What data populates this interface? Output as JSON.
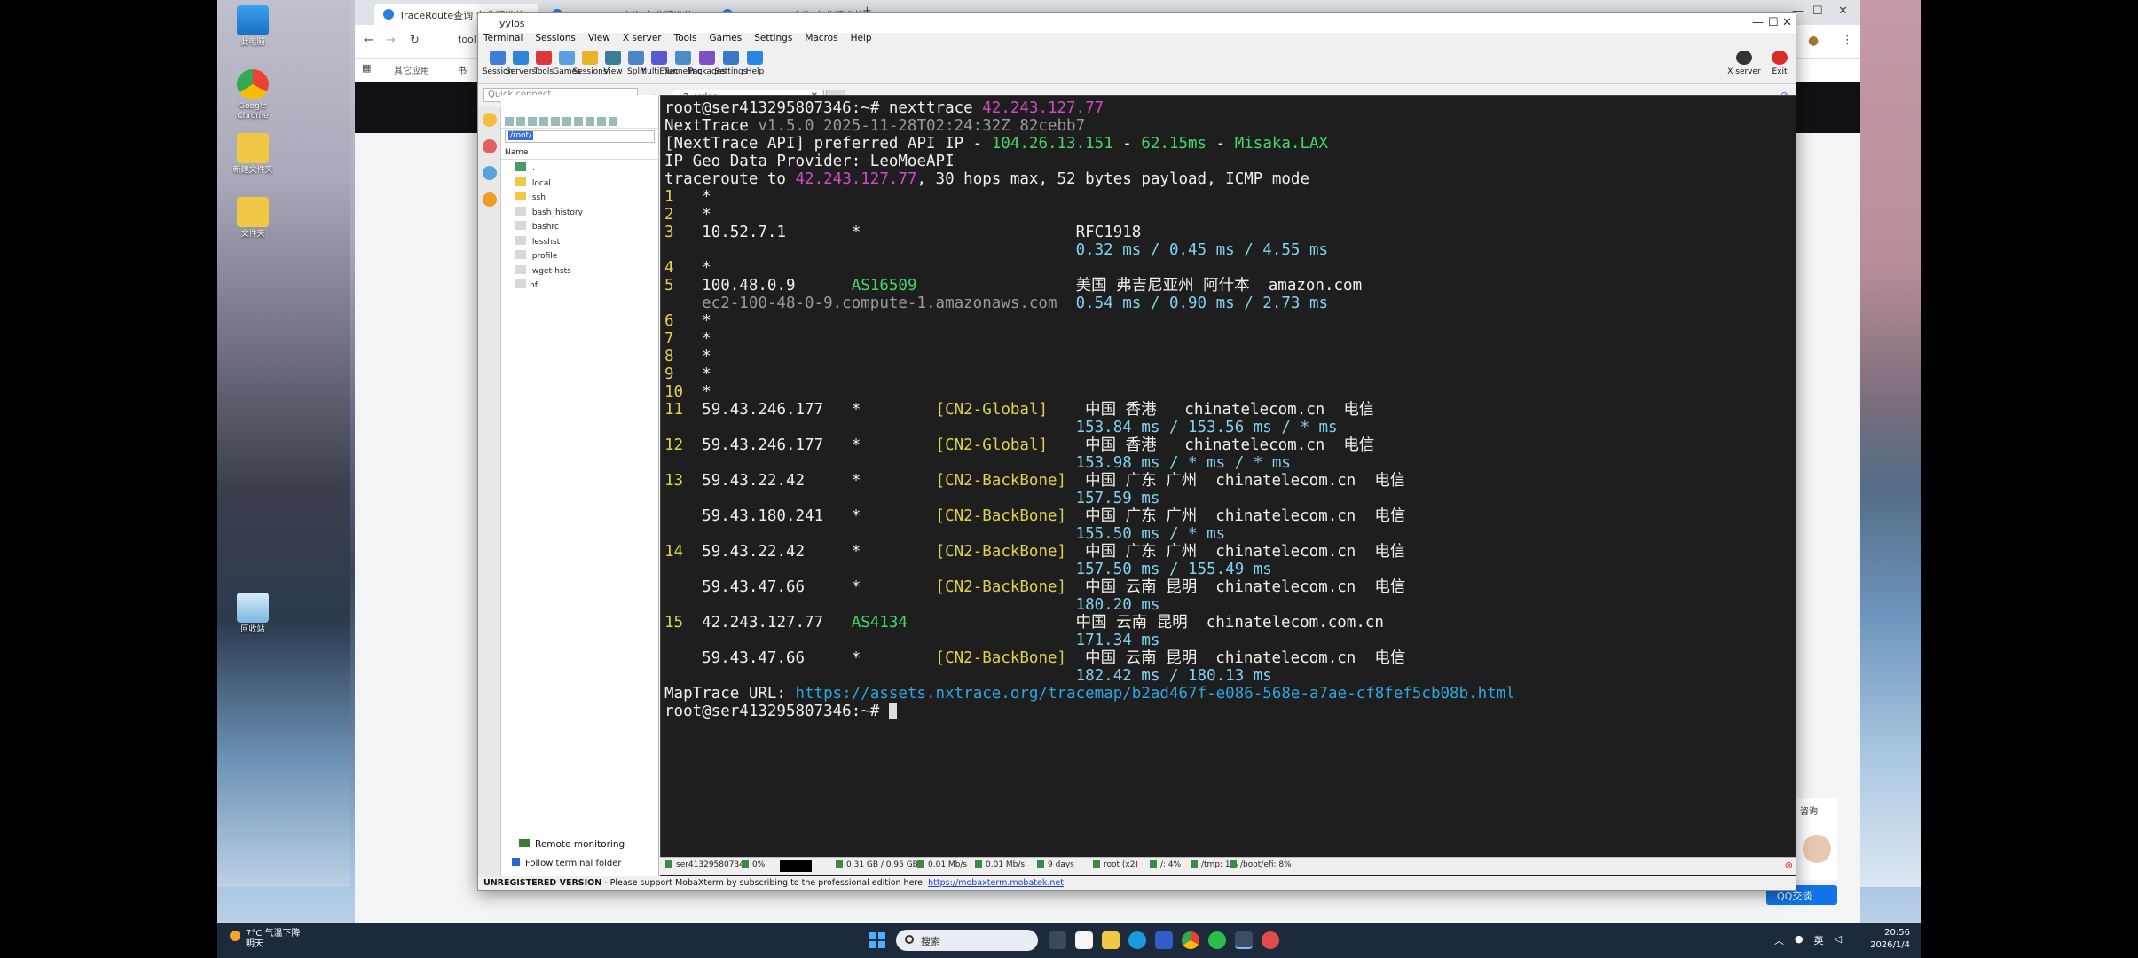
{
  "desktop": {
    "icons": [
      {
        "label": "此电脑"
      },
      {
        "label": "Google Chrome"
      },
      {
        "label": "新建文件夹"
      },
      {
        "label": "文件夹"
      },
      {
        "label": "回收站"
      }
    ]
  },
  "browser": {
    "tabs": [
      {
        "label": "TraceRoute查询 专业精准的IP..."
      },
      {
        "label": "TraceRoute查询 专业精准的IP..."
      },
      {
        "label": "TraceRoute查询 专业精准的IP..."
      }
    ],
    "address_text": "tool",
    "bookmarks": [
      "其它应用",
      "书"
    ]
  },
  "mobaxterm": {
    "window_title": "yylos",
    "menu": [
      "Terminal",
      "Sessions",
      "View",
      "X server",
      "Tools",
      "Games",
      "Settings",
      "Macros",
      "Help"
    ],
    "toolbar": [
      {
        "label": "Session",
        "icon": "session-icon",
        "color": "#3d7fd6"
      },
      {
        "label": "Servers",
        "icon": "servers-icon",
        "color": "#2f86d8"
      },
      {
        "label": "Tools",
        "icon": "tools-icon",
        "color": "#d93a3a"
      },
      {
        "label": "Games",
        "icon": "games-icon",
        "color": "#5aa0e0"
      },
      {
        "label": "Sessions",
        "icon": "sessions-icon",
        "color": "#e8b52a"
      },
      {
        "label": "View",
        "icon": "view-icon",
        "color": "#3a7d9a"
      },
      {
        "label": "Split",
        "icon": "split-icon",
        "color": "#4a86c8"
      },
      {
        "label": "MultiExec",
        "icon": "multiexec-icon",
        "color": "#5a5ad0"
      },
      {
        "label": "Tunneling",
        "icon": "tunneling-icon",
        "color": "#4c8cc8"
      },
      {
        "label": "Packages",
        "icon": "packages-icon",
        "color": "#7c4fc2"
      },
      {
        "label": "Settings",
        "icon": "settings-icon",
        "color": "#3a78c8"
      },
      {
        "label": "Help",
        "icon": "help-icon",
        "color": "#2a86e0"
      }
    ],
    "toolbar_right": [
      {
        "label": "X server",
        "color": "#333333"
      },
      {
        "label": "Exit",
        "color": "#d92b2b"
      }
    ],
    "quick_connect_placeholder": "Quick connect...",
    "tab_label": "2. yylos",
    "sidebar": {
      "path": "/root/",
      "column_header": "Name",
      "files": [
        "..",
        ".local",
        ".ssh",
        ".bash_history",
        ".bashrc",
        ".lesshst",
        ".profile",
        ".wget-hsts",
        "nf"
      ],
      "remote_monitoring": "Remote monitoring",
      "follow_folder": "Follow terminal folder"
    },
    "status": [
      "ser413295807346",
      "0%",
      "0.31 GB / 0.95 GB",
      "0.01 Mb/s",
      "0.01 Mb/s",
      "9 days",
      "root (x2)",
      "/: 4%",
      "/tmp: 1%",
      "/boot/efi: 8%"
    ],
    "unregistered": {
      "label": "UNREGISTERED VERSION",
      "message": " - Please support MobaXterm by subscribing to the professional edition here: ",
      "link": "https://mobaxterm.mobatek.net"
    }
  },
  "terminal": {
    "lines": [
      [
        {
          "t": "root@ser413295807346:~# nexttrace ",
          "c": ""
        },
        {
          "t": "42.243.127.77",
          "c": "cmag"
        }
      ],
      [
        {
          "t": "NextTrace ",
          "c": ""
        },
        {
          "t": "v1.5.0 2025-11-28T02:24:32Z 82cebb7",
          "c": "cgray"
        }
      ],
      [
        {
          "t": "[NextTrace API] preferred API IP - ",
          "c": ""
        },
        {
          "t": "104.26.13.151",
          "c": "cgreen"
        },
        {
          "t": " - ",
          "c": ""
        },
        {
          "t": "62.15ms",
          "c": "cgreen"
        },
        {
          "t": " - ",
          "c": ""
        },
        {
          "t": "Misaka.LAX",
          "c": "cgreen"
        }
      ],
      [
        {
          "t": "IP Geo Data Provider: LeoMoeAPI",
          "c": ""
        }
      ],
      [
        {
          "t": "traceroute to ",
          "c": ""
        },
        {
          "t": "42.243.127.77",
          "c": "cmag"
        },
        {
          "t": ", 30 hops max, 52 bytes payload, ICMP mode",
          "c": ""
        }
      ],
      [
        {
          "t": "1   ",
          "c": "cyel"
        },
        {
          "t": "*",
          "c": ""
        }
      ],
      [
        {
          "t": "2   ",
          "c": "cyel"
        },
        {
          "t": "*",
          "c": ""
        }
      ],
      [
        {
          "t": "3   ",
          "c": "cyel"
        },
        {
          "t": "10.52.7.1       *                       RFC1918",
          "c": ""
        }
      ],
      [
        {
          "t": "                                            0.32 ms / 0.45 ms / 4.55 ms",
          "c": "ccyan"
        }
      ],
      [
        {
          "t": "4   ",
          "c": "cyel"
        },
        {
          "t": "*",
          "c": ""
        }
      ],
      [
        {
          "t": "5   ",
          "c": "cyel"
        },
        {
          "t": "100.48.0.9      ",
          "c": ""
        },
        {
          "t": "AS16509",
          "c": "cgreen"
        },
        {
          "t": "                 美国 弗吉尼亚州 阿什本  amazon.com",
          "c": ""
        }
      ],
      [
        {
          "t": "    ec2-100-48-0-9.compute-1.amazonaws.com",
          "c": "cgray"
        },
        {
          "t": "  0.54 ms / 0.90 ms / 2.73 ms",
          "c": "ccyan"
        }
      ],
      [
        {
          "t": "6   ",
          "c": "cyel"
        },
        {
          "t": "*",
          "c": ""
        }
      ],
      [
        {
          "t": "7   ",
          "c": "cyel"
        },
        {
          "t": "*",
          "c": ""
        }
      ],
      [
        {
          "t": "8   ",
          "c": "cyel"
        },
        {
          "t": "*",
          "c": ""
        }
      ],
      [
        {
          "t": "9   ",
          "c": "cyel"
        },
        {
          "t": "*",
          "c": ""
        }
      ],
      [
        {
          "t": "10  ",
          "c": "cyel"
        },
        {
          "t": "*",
          "c": ""
        }
      ],
      [
        {
          "t": "11  ",
          "c": "cyel"
        },
        {
          "t": "59.43.246.177   *        ",
          "c": ""
        },
        {
          "t": "[CN2-Global]",
          "c": "cyel"
        },
        {
          "t": "    中国 香港   chinatelecom.cn  电信",
          "c": ""
        }
      ],
      [
        {
          "t": "                                            153.84 ms / 153.56 ms / * ms",
          "c": "ccyan"
        }
      ],
      [
        {
          "t": "12  ",
          "c": "cyel"
        },
        {
          "t": "59.43.246.177   *        ",
          "c": ""
        },
        {
          "t": "[CN2-Global]",
          "c": "cyel"
        },
        {
          "t": "    中国 香港   chinatelecom.cn  电信",
          "c": ""
        }
      ],
      [
        {
          "t": "                                            153.98 ms / * ms / * ms",
          "c": "ccyan"
        }
      ],
      [
        {
          "t": "13  ",
          "c": "cyel"
        },
        {
          "t": "59.43.22.42     *        ",
          "c": ""
        },
        {
          "t": "[CN2-BackBone]",
          "c": "cyel"
        },
        {
          "t": "  中国 广东 广州  chinatelecom.cn  电信",
          "c": ""
        }
      ],
      [
        {
          "t": "                                            157.59 ms",
          "c": "ccyan"
        }
      ],
      [
        {
          "t": "    59.43.180.241   *        ",
          "c": ""
        },
        {
          "t": "[CN2-BackBone]",
          "c": "cyel"
        },
        {
          "t": "  中国 广东 广州  chinatelecom.cn  电信",
          "c": ""
        }
      ],
      [
        {
          "t": "                                            155.50 ms / * ms",
          "c": "ccyan"
        }
      ],
      [
        {
          "t": "14  ",
          "c": "cyel"
        },
        {
          "t": "59.43.22.42     *        ",
          "c": ""
        },
        {
          "t": "[CN2-BackBone]",
          "c": "cyel"
        },
        {
          "t": "  中国 广东 广州  chinatelecom.cn  电信",
          "c": ""
        }
      ],
      [
        {
          "t": "                                            157.50 ms / 155.49 ms",
          "c": "ccyan"
        }
      ],
      [
        {
          "t": "    59.43.47.66     *        ",
          "c": ""
        },
        {
          "t": "[CN2-BackBone]",
          "c": "cyel"
        },
        {
          "t": "  中国 云南 昆明  chinatelecom.cn  电信",
          "c": ""
        }
      ],
      [
        {
          "t": "                                            180.20 ms",
          "c": "ccyan"
        }
      ],
      [
        {
          "t": "15  ",
          "c": "cyel"
        },
        {
          "t": "42.243.127.77   ",
          "c": ""
        },
        {
          "t": "AS4134",
          "c": "cgreen"
        },
        {
          "t": "                  中国 云南 昆明  chinatelecom.com.cn",
          "c": ""
        }
      ],
      [
        {
          "t": "                                            171.34 ms",
          "c": "ccyan"
        }
      ],
      [
        {
          "t": "    59.43.47.66     *        ",
          "c": ""
        },
        {
          "t": "[CN2-BackBone]",
          "c": "cyel"
        },
        {
          "t": "  中国 云南 昆明  chinatelecom.cn  电信",
          "c": ""
        }
      ],
      [
        {
          "t": "                                            182.42 ms / 180.13 ms",
          "c": "ccyan"
        }
      ],
      [
        {
          "t": "MapTrace URL: ",
          "c": ""
        },
        {
          "t": "https://assets.nxtrace.org/tracemap/b2ad467f-e086-568e-a7ae-cf8fef5cb08b.html",
          "c": "clink"
        }
      ],
      [
        {
          "t": "root@ser413295807346:~# ",
          "c": ""
        }
      ]
    ]
  },
  "page": {
    "consult_label": "咨询",
    "qq_label": "QQ交谈"
  },
  "taskbar": {
    "weather_line1": "7°C 气温下降",
    "weather_line2": "明天",
    "search_placeholder": "搜索",
    "ime": "英",
    "time": "20:56",
    "date": "2026/1/4"
  }
}
